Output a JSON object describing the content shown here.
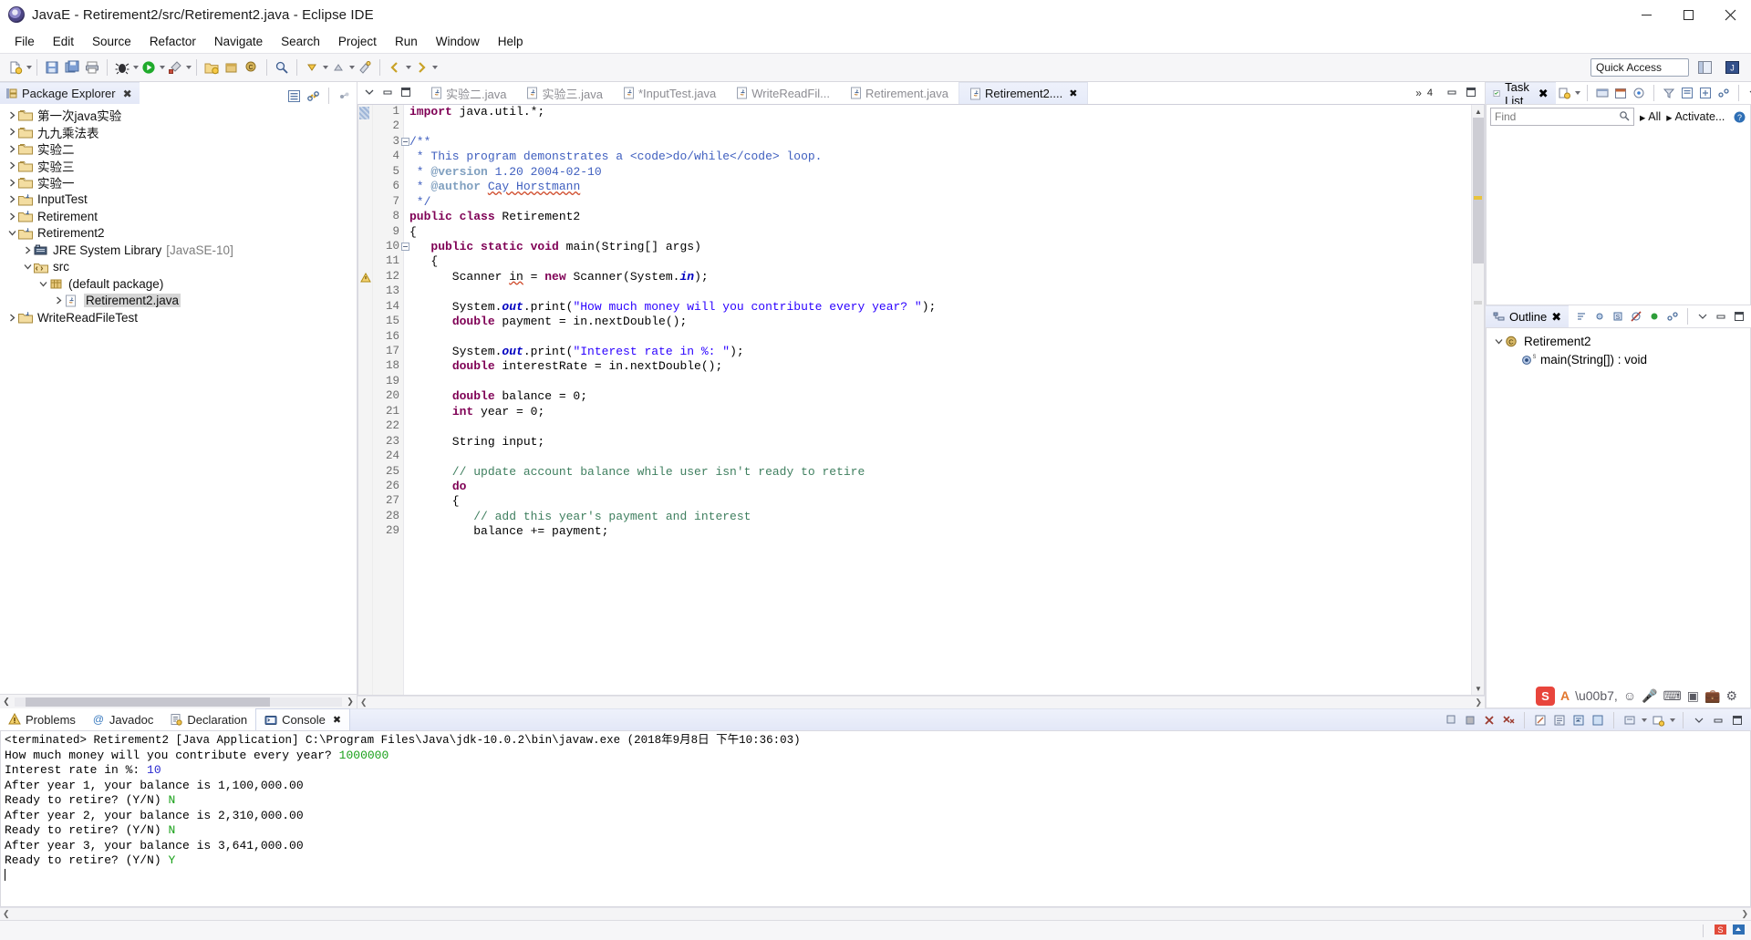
{
  "window": {
    "title": "JavaE - Retirement2/src/Retirement2.java - Eclipse IDE",
    "minimize": "─",
    "maximize": "☐",
    "close": "✕"
  },
  "menubar": [
    "File",
    "Edit",
    "Source",
    "Refactor",
    "Navigate",
    "Search",
    "Project",
    "Run",
    "Window",
    "Help"
  ],
  "toolbar": {
    "quick_access": "Quick Access"
  },
  "package_explorer": {
    "title": "Package Explorer",
    "close": "✖",
    "items": [
      {
        "label": "第一次java实验",
        "indent": 0,
        "twist": "collapsed",
        "icon": "project-icon"
      },
      {
        "label": "九九乘法表",
        "indent": 0,
        "twist": "collapsed",
        "icon": "project-icon"
      },
      {
        "label": "实验二",
        "indent": 0,
        "twist": "collapsed",
        "icon": "project-icon"
      },
      {
        "label": "实验三",
        "indent": 0,
        "twist": "collapsed",
        "icon": "project-icon"
      },
      {
        "label": "实验一",
        "indent": 0,
        "twist": "collapsed",
        "icon": "project-icon"
      },
      {
        "label": "InputTest",
        "indent": 0,
        "twist": "collapsed",
        "icon": "java-project-icon"
      },
      {
        "label": "Retirement",
        "indent": 0,
        "twist": "collapsed",
        "icon": "java-project-icon"
      },
      {
        "label": "Retirement2",
        "indent": 0,
        "twist": "expanded",
        "icon": "java-project-icon"
      },
      {
        "label": "JRE System Library",
        "suffix": "[JavaSE-10]",
        "indent": 1,
        "twist": "collapsed",
        "icon": "library-icon"
      },
      {
        "label": "src",
        "indent": 1,
        "twist": "expanded",
        "icon": "source-folder-icon"
      },
      {
        "label": "(default package)",
        "indent": 2,
        "twist": "expanded",
        "icon": "package-icon"
      },
      {
        "label": "Retirement2.java",
        "indent": 3,
        "twist": "collapsed",
        "icon": "java-file-icon",
        "selected": true
      },
      {
        "label": "WriteReadFileTest",
        "indent": 0,
        "twist": "collapsed",
        "icon": "java-project-icon"
      }
    ]
  },
  "editor": {
    "tabs": [
      {
        "label": "实验二.java",
        "active": false,
        "dirty": false
      },
      {
        "label": "实验三.java",
        "active": false,
        "dirty": false
      },
      {
        "label": "*InputTest.java",
        "active": false,
        "dirty": true
      },
      {
        "label": "WriteReadFil...",
        "active": false,
        "dirty": false
      },
      {
        "label": "Retirement.java",
        "active": false,
        "dirty": false
      },
      {
        "label": "Retirement2....",
        "active": true,
        "dirty": false
      }
    ],
    "close_mark": "✖",
    "overflow_chevron": "»",
    "overflow_count": "4",
    "lines": [
      {
        "n": "1",
        "fold": false,
        "tokens": [
          {
            "t": "import ",
            "c": "k"
          },
          {
            "t": "java.util.*;",
            "c": "plain"
          }
        ]
      },
      {
        "n": "2",
        "fold": false,
        "tokens": []
      },
      {
        "n": "3",
        "fold": true,
        "tokens": [
          {
            "t": "/**",
            "c": "jd"
          }
        ]
      },
      {
        "n": "4",
        "fold": false,
        "tokens": [
          {
            "t": " * This program demonstrates a <code>do/while</code> loop.",
            "c": "jd"
          }
        ]
      },
      {
        "n": "5",
        "fold": false,
        "tokens": [
          {
            "t": " * ",
            "c": "jd"
          },
          {
            "t": "@version",
            "c": "jdt"
          },
          {
            "t": " 1.20 2004-02-10",
            "c": "jd"
          }
        ]
      },
      {
        "n": "6",
        "fold": false,
        "tokens": [
          {
            "t": " * ",
            "c": "jd"
          },
          {
            "t": "@author",
            "c": "jdt"
          },
          {
            "t": " ",
            "c": "jd"
          },
          {
            "t": "Cay Horstmann",
            "c": "jd sq"
          }
        ]
      },
      {
        "n": "7",
        "fold": false,
        "tokens": [
          {
            "t": " */",
            "c": "jd"
          }
        ]
      },
      {
        "n": "8",
        "fold": false,
        "tokens": [
          {
            "t": "public class ",
            "c": "k"
          },
          {
            "t": "Retirement2",
            "c": "plain"
          }
        ]
      },
      {
        "n": "9",
        "fold": false,
        "tokens": [
          {
            "t": "{",
            "c": "plain"
          }
        ]
      },
      {
        "n": "10",
        "fold": true,
        "tokens": [
          {
            "t": "   ",
            "c": "plain"
          },
          {
            "t": "public static void ",
            "c": "k"
          },
          {
            "t": "main(String[] args)",
            "c": "plain"
          }
        ]
      },
      {
        "n": "11",
        "fold": false,
        "tokens": [
          {
            "t": "   {",
            "c": "plain"
          }
        ]
      },
      {
        "n": "12",
        "fold": false,
        "marker": "warning",
        "tokens": [
          {
            "t": "      Scanner ",
            "c": "plain"
          },
          {
            "t": "in",
            "c": "plain sq"
          },
          {
            "t": " = ",
            "c": "plain"
          },
          {
            "t": "new ",
            "c": "k"
          },
          {
            "t": "Scanner(System.",
            "c": "plain"
          },
          {
            "t": "in",
            "c": "fld"
          },
          {
            "t": ");",
            "c": "plain"
          }
        ]
      },
      {
        "n": "13",
        "fold": false,
        "tokens": []
      },
      {
        "n": "14",
        "fold": false,
        "tokens": [
          {
            "t": "      System.",
            "c": "plain"
          },
          {
            "t": "out",
            "c": "fld"
          },
          {
            "t": ".print(",
            "c": "plain"
          },
          {
            "t": "\"How much money will you contribute every year? \"",
            "c": "s"
          },
          {
            "t": ");",
            "c": "plain"
          }
        ]
      },
      {
        "n": "15",
        "fold": false,
        "tokens": [
          {
            "t": "      ",
            "c": "plain"
          },
          {
            "t": "double ",
            "c": "k"
          },
          {
            "t": "payment = in.nextDouble();",
            "c": "plain"
          }
        ]
      },
      {
        "n": "16",
        "fold": false,
        "tokens": []
      },
      {
        "n": "17",
        "fold": false,
        "tokens": [
          {
            "t": "      System.",
            "c": "plain"
          },
          {
            "t": "out",
            "c": "fld"
          },
          {
            "t": ".print(",
            "c": "plain"
          },
          {
            "t": "\"Interest rate in %: \"",
            "c": "s"
          },
          {
            "t": ");",
            "c": "plain"
          }
        ]
      },
      {
        "n": "18",
        "fold": false,
        "tokens": [
          {
            "t": "      ",
            "c": "plain"
          },
          {
            "t": "double ",
            "c": "k"
          },
          {
            "t": "interestRate = in.nextDouble();",
            "c": "plain"
          }
        ]
      },
      {
        "n": "19",
        "fold": false,
        "tokens": []
      },
      {
        "n": "20",
        "fold": false,
        "tokens": [
          {
            "t": "      ",
            "c": "plain"
          },
          {
            "t": "double ",
            "c": "k"
          },
          {
            "t": "balance = 0;",
            "c": "plain"
          }
        ]
      },
      {
        "n": "21",
        "fold": false,
        "tokens": [
          {
            "t": "      ",
            "c": "plain"
          },
          {
            "t": "int ",
            "c": "k"
          },
          {
            "t": "year = 0;",
            "c": "plain"
          }
        ]
      },
      {
        "n": "22",
        "fold": false,
        "tokens": []
      },
      {
        "n": "23",
        "fold": false,
        "tokens": [
          {
            "t": "      String input;",
            "c": "plain"
          }
        ]
      },
      {
        "n": "24",
        "fold": false,
        "tokens": []
      },
      {
        "n": "25",
        "fold": false,
        "tokens": [
          {
            "t": "      // update account balance while user isn't ready to retire",
            "c": "c"
          }
        ]
      },
      {
        "n": "26",
        "fold": false,
        "tokens": [
          {
            "t": "      ",
            "c": "plain"
          },
          {
            "t": "do",
            "c": "k"
          }
        ]
      },
      {
        "n": "27",
        "fold": false,
        "tokens": [
          {
            "t": "      {",
            "c": "plain"
          }
        ]
      },
      {
        "n": "28",
        "fold": false,
        "tokens": [
          {
            "t": "         // add this year's payment and interest",
            "c": "c"
          }
        ]
      },
      {
        "n": "29",
        "fold": false,
        "clipped": true,
        "tokens": [
          {
            "t": "         balance += payment;",
            "c": "plain"
          }
        ]
      }
    ]
  },
  "task_list": {
    "title": "Task List",
    "close": "✖",
    "find_placeholder": "Find",
    "all_label": "All",
    "activate_label": "Activate..."
  },
  "outline": {
    "title": "Outline",
    "close": "✖",
    "items": [
      {
        "label": "Retirement2",
        "indent": 0,
        "twist": "expanded",
        "icon": "class-icon"
      },
      {
        "label": "main(String[]) : void",
        "indent": 1,
        "twist": "none",
        "icon": "method-public-static-icon"
      }
    ]
  },
  "bottom_panel": {
    "tabs": [
      {
        "label": "Problems",
        "icon": "problems-icon",
        "active": false
      },
      {
        "label": "Javadoc",
        "icon": "javadoc-icon",
        "active": false
      },
      {
        "label": "Declaration",
        "icon": "declaration-icon",
        "active": false
      },
      {
        "label": "Console",
        "icon": "console-icon",
        "active": true
      }
    ],
    "close_mark": "✖",
    "console_header": "<terminated> Retirement2 [Java Application] C:\\Program Files\\Java\\jdk-10.0.2\\bin\\javaw.exe (2018年9月8日 下午10:36:03)",
    "console_lines": [
      {
        "parts": [
          {
            "t": "How much money will you contribute every year? ",
            "c": "plain"
          },
          {
            "t": "1000000",
            "c": "cgreen"
          }
        ]
      },
      {
        "parts": [
          {
            "t": "Interest rate in %: ",
            "c": "plain"
          },
          {
            "t": "10",
            "c": "cblue"
          }
        ]
      },
      {
        "parts": [
          {
            "t": "After year 1, your balance is 1,100,000.00",
            "c": "plain"
          }
        ]
      },
      {
        "parts": [
          {
            "t": "Ready to retire? (Y/N) ",
            "c": "plain"
          },
          {
            "t": "N",
            "c": "cgreen"
          }
        ]
      },
      {
        "parts": [
          {
            "t": "After year 2, your balance is 2,310,000.00",
            "c": "plain"
          }
        ]
      },
      {
        "parts": [
          {
            "t": "Ready to retire? (Y/N) ",
            "c": "plain"
          },
          {
            "t": "N",
            "c": "cgreen"
          }
        ]
      },
      {
        "parts": [
          {
            "t": "After year 3, your balance is 3,641,000.00",
            "c": "plain"
          }
        ]
      },
      {
        "parts": [
          {
            "t": "Ready to retire? (Y/N) ",
            "c": "plain"
          },
          {
            "t": "Y",
            "c": "cgreen"
          }
        ]
      }
    ]
  },
  "statusbar": {
    "text": ""
  },
  "colors": {
    "keyword": "#7f0055",
    "string": "#2a00ff",
    "comment": "#3f7f5f",
    "javadoc": "#3f5fbf",
    "field": "#0000c0",
    "console_green": "#18a018",
    "console_blue": "#2a2ad0",
    "tab_active": "#e6ebf9"
  }
}
